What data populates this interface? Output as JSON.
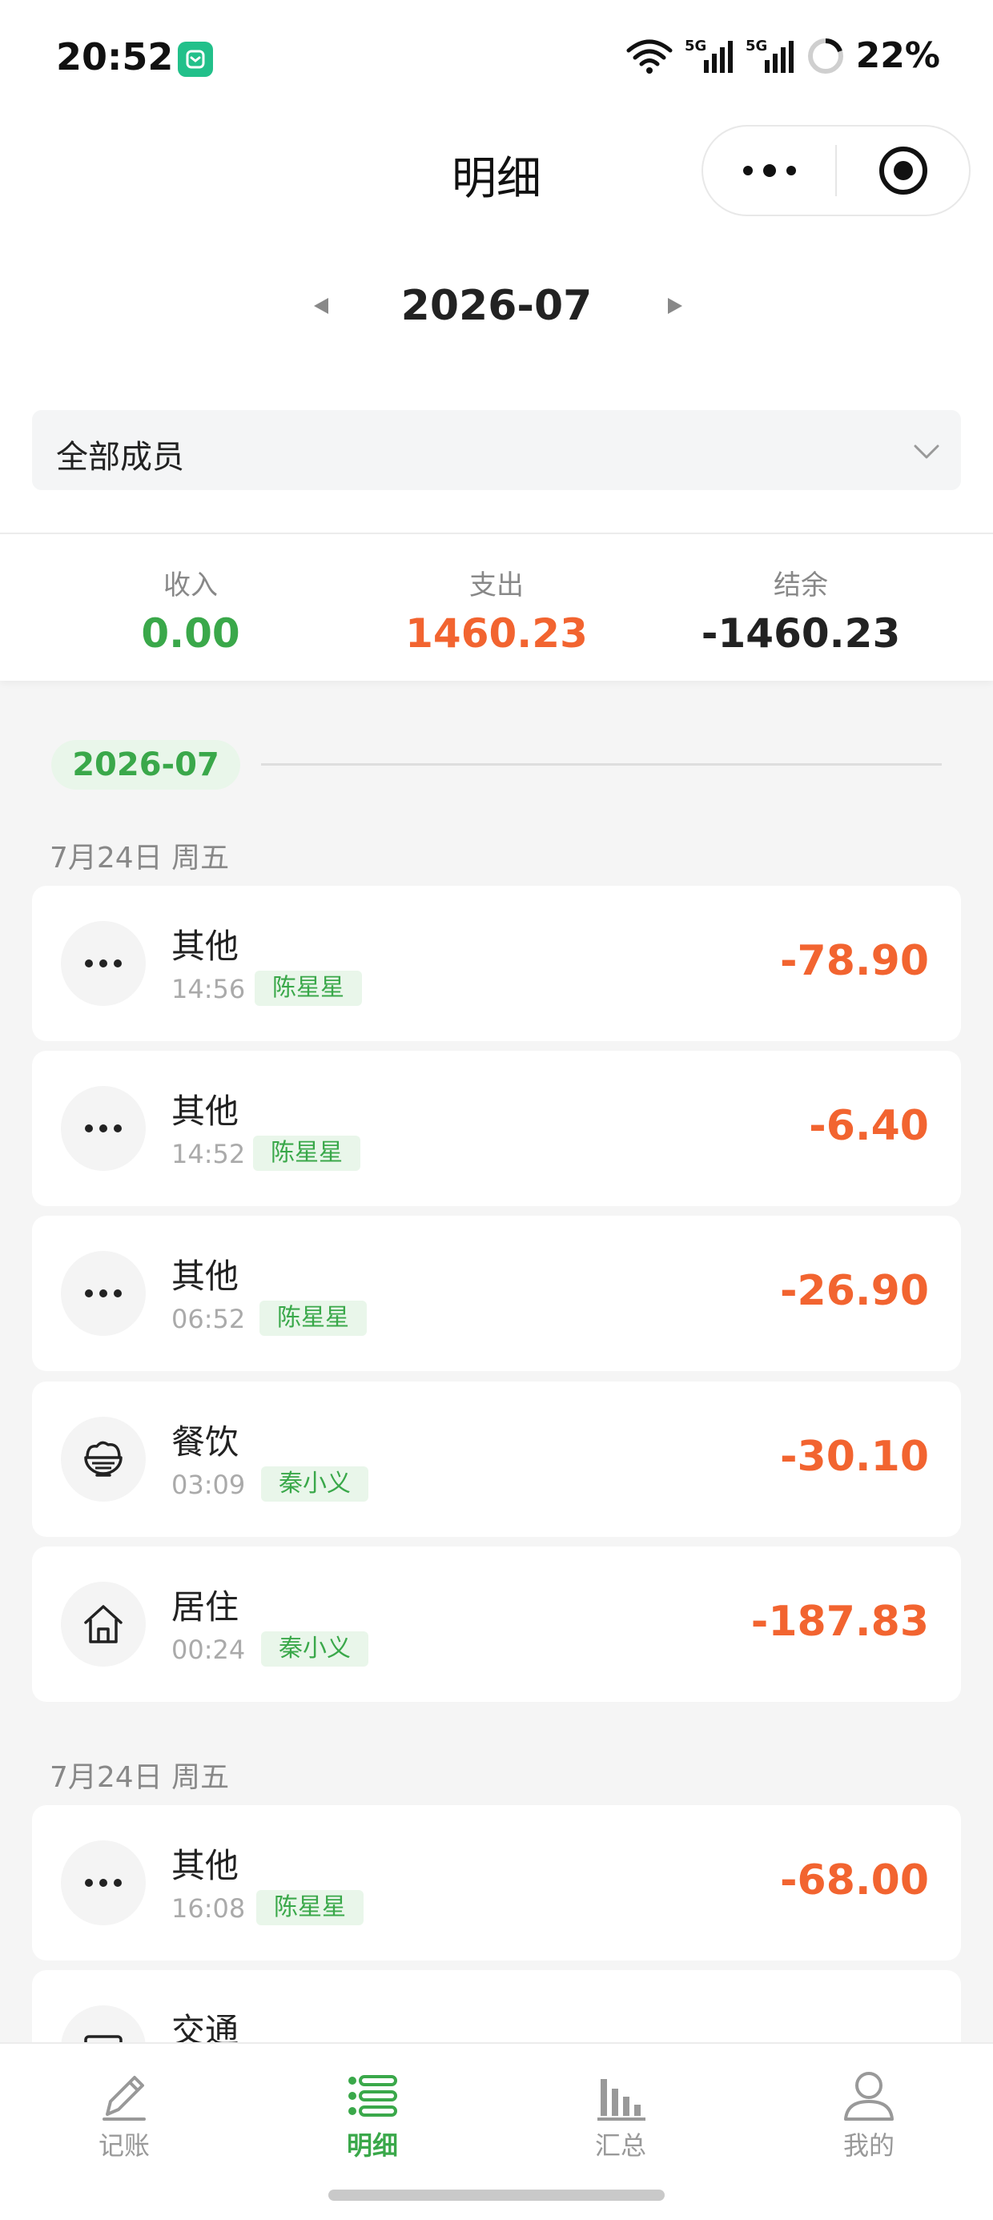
{
  "status_bar": {
    "time": "20:52",
    "network_1": "5G",
    "network_2": "5G",
    "battery": "22%"
  },
  "nav": {
    "title": "明细"
  },
  "month_selector": {
    "prev_icon": "triangle-left-icon",
    "label": "2026-07",
    "next_icon": "triangle-right-icon"
  },
  "member_filter": {
    "label": "全部成员"
  },
  "summary": {
    "income_label": "收入",
    "income_value": "0.00",
    "expense_label": "支出",
    "expense_value": "1460.23",
    "balance_label": "结余",
    "balance_value": "-1460.23"
  },
  "month_group": {
    "label": "2026-07"
  },
  "day_groups": [
    {
      "header": "7月24日 周五",
      "items": [
        {
          "category": "其他",
          "time": "14:56",
          "member": "陈星星",
          "amount": "-78.90",
          "icon": "more-dots-icon"
        },
        {
          "category": "其他",
          "time": "14:52",
          "member": "陈星星",
          "amount": "-6.40",
          "icon": "more-dots-icon"
        },
        {
          "category": "其他",
          "time": "06:52",
          "member": "陈星星",
          "amount": "-26.90",
          "icon": "more-dots-icon"
        },
        {
          "category": "餐饮",
          "time": "03:09",
          "member": "秦小义",
          "amount": "-30.10",
          "icon": "bowl-icon"
        },
        {
          "category": "居住",
          "time": "00:24",
          "member": "秦小义",
          "amount": "-187.83",
          "icon": "house-icon"
        }
      ]
    },
    {
      "header": "7月24日 周五",
      "items": [
        {
          "category": "其他",
          "time": "16:08",
          "member": "陈星星",
          "amount": "-68.00",
          "icon": "more-dots-icon"
        },
        {
          "category": "交通",
          "icon": "card-icon"
        }
      ]
    }
  ],
  "tab_bar": {
    "tabs": [
      {
        "label": "记账",
        "icon": "pencil-icon"
      },
      {
        "label": "明细",
        "icon": "list-icon",
        "active": true
      },
      {
        "label": "汇总",
        "icon": "bar-chart-icon"
      },
      {
        "label": "我的",
        "icon": "user-icon"
      }
    ]
  },
  "colors": {
    "accent_green": "#3aa84a",
    "expense_orange": "#f26430"
  }
}
